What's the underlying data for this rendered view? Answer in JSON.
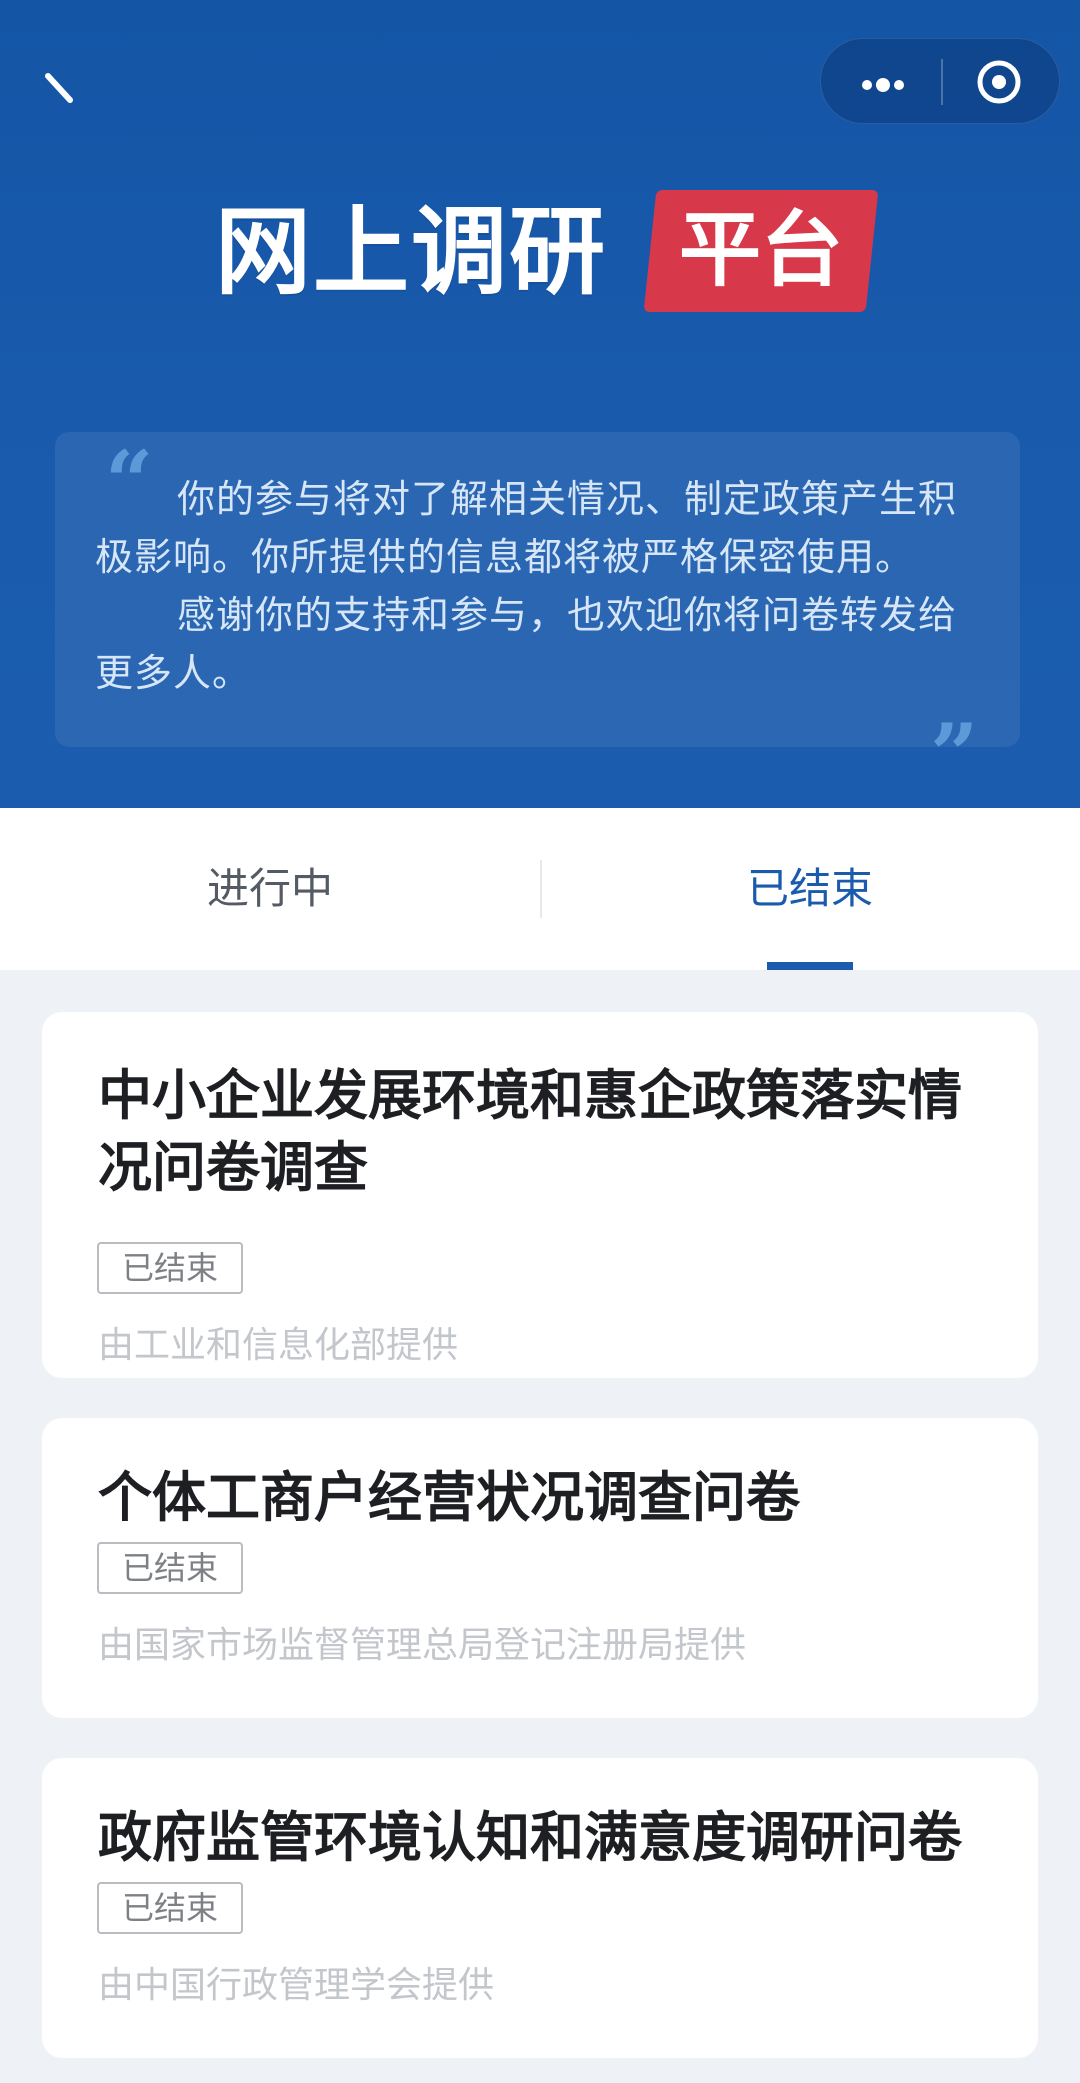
{
  "header": {
    "title_main": "网上调研",
    "title_badge": "平台",
    "intro_paragraphs": [
      "你的参与将对了解相关情况、制定政策产生积极影响。你所提供的信息都将被严格保密使用。",
      "感谢你的支持和参与，也欢迎你将问卷转发给更多人。"
    ],
    "quote_open": "“",
    "quote_close": "”",
    "colors": {
      "header_bg": "#1a5bad",
      "badge_bg": "#d7394a",
      "accent": "#1a5bad"
    }
  },
  "tabs": [
    {
      "label": "进行中",
      "active": false
    },
    {
      "label": "已结束",
      "active": true
    }
  ],
  "surveys": [
    {
      "title": "中小企业发展环境和惠企政策落实情况问卷调查",
      "status": "已结束",
      "provider": "由工业和信息化部提供"
    },
    {
      "title": "个体工商户经营状况调查问卷",
      "status": "已结束",
      "provider": "由国家市场监督管理总局登记注册局提供"
    },
    {
      "title": "政府监管环境认知和满意度调研问卷",
      "status": "已结束",
      "provider": "由中国行政管理学会提供"
    }
  ],
  "icons": {
    "back": "back-arrow-icon",
    "more": "more-dots-icon",
    "close": "target-circle-icon"
  }
}
